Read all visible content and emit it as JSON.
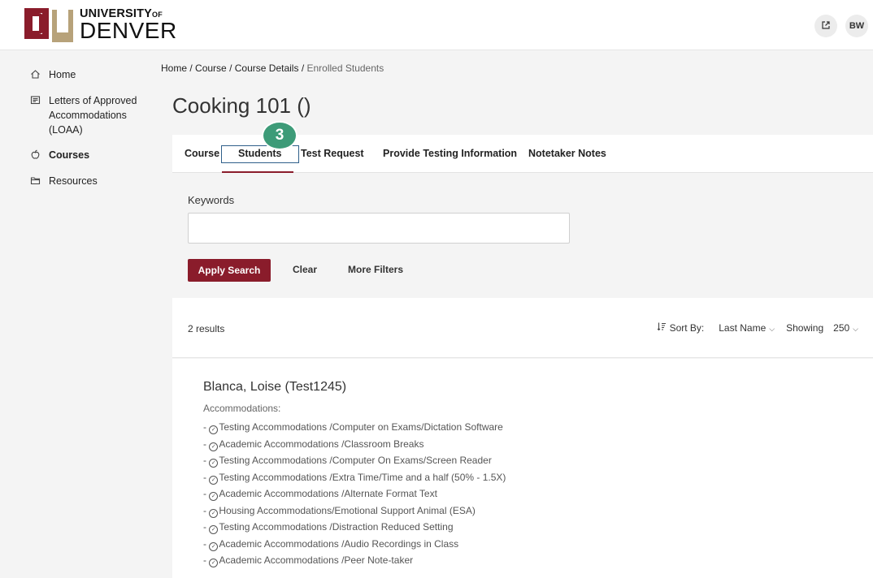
{
  "header": {
    "logo_top": "UNIVERSITY",
    "logo_of": "OF",
    "logo_bottom": "DENVER",
    "external_icon": "external-link-icon",
    "avatar_initials": "BW",
    "brand_color": "#8a1c2b"
  },
  "sidebar": {
    "items": [
      {
        "label": "Home",
        "icon": "home-icon"
      },
      {
        "label": "Letters of Approved Accommodations (LOAA)",
        "icon": "letter-icon"
      },
      {
        "label": "Courses",
        "icon": "apple-icon",
        "active": true
      },
      {
        "label": "Resources",
        "icon": "folder-icon"
      }
    ]
  },
  "breadcrumb": {
    "items": [
      "Home",
      "Course",
      "Course Details"
    ],
    "separator": "/",
    "current": "Enrolled Students"
  },
  "page": {
    "title": "Cooking 101 ()"
  },
  "tabs": {
    "items": [
      "Course",
      "Students",
      "Test Request",
      "Provide Testing Information",
      "Notetaker Notes"
    ],
    "active": "Students"
  },
  "step_badge": "3",
  "search": {
    "keywords_label": "Keywords",
    "keywords_value": "",
    "apply_label": "Apply Search",
    "clear_label": "Clear",
    "more_filters_label": "More Filters"
  },
  "results": {
    "count_text": "2 results",
    "sort_by_label": "Sort By:",
    "sort_by_value": "Last Name",
    "showing_label": "Showing",
    "showing_value": "250"
  },
  "students": [
    {
      "name": "Blanca, Loise (Test1245)",
      "accommodations_label": "Accommodations:",
      "accommodations": [
        "Testing Accommodations /Computer on Exams/Dictation Software",
        "Academic Accommodations /Classroom Breaks",
        "Testing Accommodations /Computer On Exams/Screen Reader",
        "Testing Accommodations /Extra Time/Time and a half (50% - 1.5X)",
        "Academic Accommodations /Alternate Format Text",
        "Housing Accommodations/Emotional Support Animal (ESA)",
        "Testing Accommodations /Distraction Reduced Setting",
        "Academic Accommodations /Audio Recordings in Class",
        "Academic Accommodations /Peer Note-taker"
      ]
    }
  ]
}
